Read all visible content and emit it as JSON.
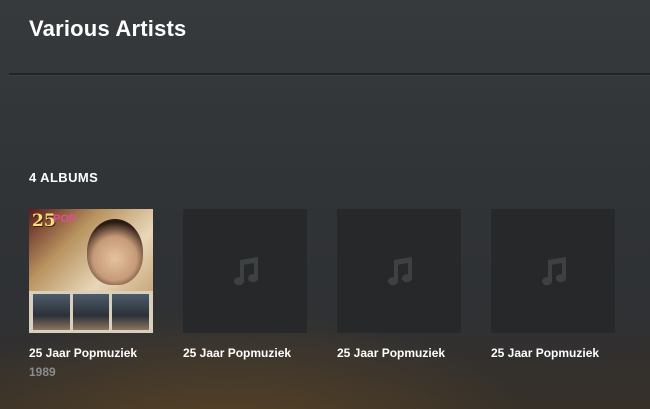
{
  "header": {
    "title": "Various Artists"
  },
  "albums_section": {
    "heading": "4 ALBUMS",
    "albums": [
      {
        "title": "25 Jaar Popmuziek",
        "year": "1989",
        "has_cover": true,
        "cover_text": {
          "number": "25",
          "word": "POP"
        }
      },
      {
        "title": "25 Jaar Popmuziek",
        "year": "",
        "has_cover": false
      },
      {
        "title": "25 Jaar Popmuziek",
        "year": "",
        "has_cover": false
      },
      {
        "title": "25 Jaar Popmuziek",
        "year": "",
        "has_cover": false
      }
    ]
  },
  "icons": {
    "placeholder": "music-note-icon"
  },
  "colors": {
    "placeholder_tile": "#262829",
    "placeholder_icon": "#3e4142",
    "year_text": "#8a8c8d"
  }
}
